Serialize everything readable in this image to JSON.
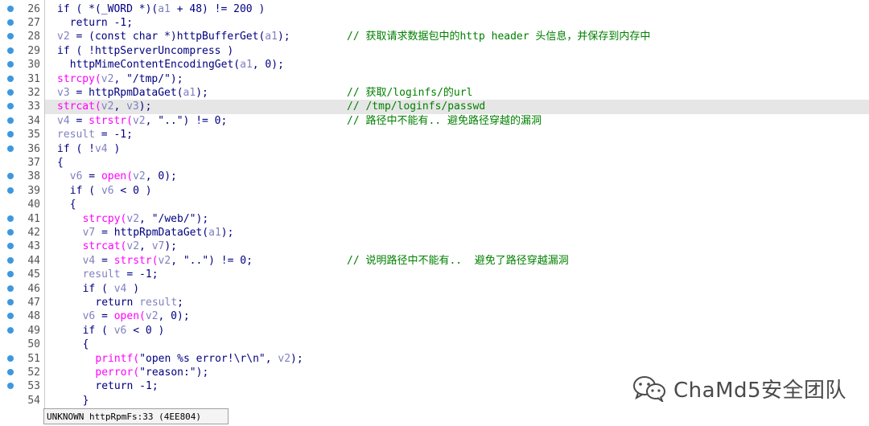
{
  "gutter_color": "#3d98e0",
  "lines": [
    {
      "num": "26",
      "bp": true,
      "indent": 1,
      "tokens": [
        {
          "t": "if ( *(_WORD *)(",
          "c": "plain"
        },
        {
          "t": "a1",
          "c": "var"
        },
        {
          "t": " + 48) != 200 )",
          "c": "plain"
        }
      ]
    },
    {
      "num": "27",
      "bp": true,
      "indent": 2,
      "tokens": [
        {
          "t": "return -1;",
          "c": "plain"
        }
      ]
    },
    {
      "num": "28",
      "bp": true,
      "indent": 1,
      "tokens": [
        {
          "t": "v2",
          "c": "var"
        },
        {
          "t": " = (const char *)",
          "c": "plain"
        },
        {
          "t": "httpBufferGet(",
          "c": "plain"
        },
        {
          "t": "a1",
          "c": "var"
        },
        {
          "t": ");",
          "c": "plain"
        }
      ],
      "comment": "// 获取请求数据包中的http header 头信息，并保存到内存中"
    },
    {
      "num": "29",
      "bp": true,
      "indent": 1,
      "tokens": [
        {
          "t": "if ( !httpServerUncompress )",
          "c": "plain"
        }
      ]
    },
    {
      "num": "30",
      "bp": true,
      "indent": 2,
      "tokens": [
        {
          "t": "httpMimeContentEncodingGet(",
          "c": "plain"
        },
        {
          "t": "a1",
          "c": "var"
        },
        {
          "t": ", 0);",
          "c": "plain"
        }
      ]
    },
    {
      "num": "31",
      "bp": true,
      "indent": 1,
      "tokens": [
        {
          "t": "strcpy(",
          "c": "fn"
        },
        {
          "t": "v2",
          "c": "var"
        },
        {
          "t": ", \"/tmp/\");",
          "c": "plain"
        }
      ]
    },
    {
      "num": "32",
      "bp": true,
      "indent": 1,
      "tokens": [
        {
          "t": "v3",
          "c": "var"
        },
        {
          "t": " = httpRpmDataGet(",
          "c": "plain"
        },
        {
          "t": "a1",
          "c": "var"
        },
        {
          "t": ");",
          "c": "plain"
        }
      ],
      "comment": "// 获取/loginfs/的url"
    },
    {
      "num": "33",
      "bp": true,
      "indent": 1,
      "hl": true,
      "tokens": [
        {
          "t": "strcat(",
          "c": "fn"
        },
        {
          "t": "v2",
          "c": "var"
        },
        {
          "t": ", ",
          "c": "plain"
        },
        {
          "t": "v3",
          "c": "var"
        },
        {
          "t": ");",
          "c": "plain"
        }
      ],
      "comment": "// /tmp/loginfs/passwd"
    },
    {
      "num": "34",
      "bp": true,
      "indent": 1,
      "tokens": [
        {
          "t": "v4",
          "c": "var"
        },
        {
          "t": " = ",
          "c": "plain"
        },
        {
          "t": "strstr(",
          "c": "fn"
        },
        {
          "t": "v2",
          "c": "var"
        },
        {
          "t": ", \"..\") != 0;",
          "c": "plain"
        }
      ],
      "comment": "// 路径中不能有.. 避免路径穿越的漏洞"
    },
    {
      "num": "35",
      "bp": true,
      "indent": 1,
      "tokens": [
        {
          "t": "result",
          "c": "var"
        },
        {
          "t": " = -1;",
          "c": "plain"
        }
      ]
    },
    {
      "num": "36",
      "bp": true,
      "indent": 1,
      "tokens": [
        {
          "t": "if ( !",
          "c": "plain"
        },
        {
          "t": "v4",
          "c": "var"
        },
        {
          "t": " )",
          "c": "plain"
        }
      ]
    },
    {
      "num": "37",
      "bp": false,
      "indent": 1,
      "tokens": [
        {
          "t": "{",
          "c": "plain"
        }
      ]
    },
    {
      "num": "38",
      "bp": true,
      "indent": 2,
      "tokens": [
        {
          "t": "v6",
          "c": "var"
        },
        {
          "t": " = ",
          "c": "plain"
        },
        {
          "t": "open(",
          "c": "fn"
        },
        {
          "t": "v2",
          "c": "var"
        },
        {
          "t": ", 0);",
          "c": "plain"
        }
      ]
    },
    {
      "num": "39",
      "bp": true,
      "indent": 2,
      "tokens": [
        {
          "t": "if ( ",
          "c": "plain"
        },
        {
          "t": "v6",
          "c": "var"
        },
        {
          "t": " < 0 )",
          "c": "plain"
        }
      ]
    },
    {
      "num": "40",
      "bp": false,
      "indent": 2,
      "tokens": [
        {
          "t": "{",
          "c": "plain"
        }
      ]
    },
    {
      "num": "41",
      "bp": true,
      "indent": 3,
      "tokens": [
        {
          "t": "strcpy(",
          "c": "fn"
        },
        {
          "t": "v2",
          "c": "var"
        },
        {
          "t": ", \"/web/\");",
          "c": "plain"
        }
      ]
    },
    {
      "num": "42",
      "bp": true,
      "indent": 3,
      "tokens": [
        {
          "t": "v7",
          "c": "var"
        },
        {
          "t": " = httpRpmDataGet(",
          "c": "plain"
        },
        {
          "t": "a1",
          "c": "var"
        },
        {
          "t": ");",
          "c": "plain"
        }
      ]
    },
    {
      "num": "43",
      "bp": true,
      "indent": 3,
      "tokens": [
        {
          "t": "strcat(",
          "c": "fn"
        },
        {
          "t": "v2",
          "c": "var"
        },
        {
          "t": ", ",
          "c": "plain"
        },
        {
          "t": "v7",
          "c": "var"
        },
        {
          "t": ");",
          "c": "plain"
        }
      ]
    },
    {
      "num": "44",
      "bp": true,
      "indent": 3,
      "tokens": [
        {
          "t": "v4",
          "c": "var"
        },
        {
          "t": " = ",
          "c": "plain"
        },
        {
          "t": "strstr(",
          "c": "fn"
        },
        {
          "t": "v2",
          "c": "var"
        },
        {
          "t": ", \"..\") != 0;",
          "c": "plain"
        }
      ],
      "comment": "// 说明路径中不能有..  避免了路径穿越漏洞"
    },
    {
      "num": "45",
      "bp": true,
      "indent": 3,
      "tokens": [
        {
          "t": "result",
          "c": "var"
        },
        {
          "t": " = -1;",
          "c": "plain"
        }
      ]
    },
    {
      "num": "46",
      "bp": true,
      "indent": 3,
      "tokens": [
        {
          "t": "if ( ",
          "c": "plain"
        },
        {
          "t": "v4",
          "c": "var"
        },
        {
          "t": " )",
          "c": "plain"
        }
      ]
    },
    {
      "num": "47",
      "bp": true,
      "indent": 4,
      "tokens": [
        {
          "t": "return ",
          "c": "plain"
        },
        {
          "t": "result",
          "c": "var"
        },
        {
          "t": ";",
          "c": "plain"
        }
      ]
    },
    {
      "num": "48",
      "bp": true,
      "indent": 3,
      "tokens": [
        {
          "t": "v6",
          "c": "var"
        },
        {
          "t": " = ",
          "c": "plain"
        },
        {
          "t": "open(",
          "c": "fn"
        },
        {
          "t": "v2",
          "c": "var"
        },
        {
          "t": ", 0);",
          "c": "plain"
        }
      ]
    },
    {
      "num": "49",
      "bp": true,
      "indent": 3,
      "tokens": [
        {
          "t": "if ( ",
          "c": "plain"
        },
        {
          "t": "v6",
          "c": "var"
        },
        {
          "t": " < 0 )",
          "c": "plain"
        }
      ]
    },
    {
      "num": "50",
      "bp": false,
      "indent": 3,
      "tokens": [
        {
          "t": "{",
          "c": "plain"
        }
      ]
    },
    {
      "num": "51",
      "bp": true,
      "indent": 4,
      "tokens": [
        {
          "t": "printf(",
          "c": "fn"
        },
        {
          "t": "\"open %s error!\\r\\n\", ",
          "c": "plain"
        },
        {
          "t": "v2",
          "c": "var"
        },
        {
          "t": ");",
          "c": "plain"
        }
      ]
    },
    {
      "num": "52",
      "bp": true,
      "indent": 4,
      "tokens": [
        {
          "t": "perror(",
          "c": "fn"
        },
        {
          "t": "\"reason:\");",
          "c": "plain"
        }
      ]
    },
    {
      "num": "53",
      "bp": true,
      "indent": 4,
      "tokens": [
        {
          "t": "return -1;",
          "c": "plain"
        }
      ]
    },
    {
      "num": "54",
      "bp": false,
      "indent": 3,
      "tokens": [
        {
          "t": "}",
          "c": "plain"
        }
      ]
    }
  ],
  "status_bar": {
    "text": "UNKNOWN httpRpmFs:33 (4EE804)"
  },
  "watermark": {
    "text": "ChaMd5安全团队",
    "icon": "wechat-icon"
  }
}
